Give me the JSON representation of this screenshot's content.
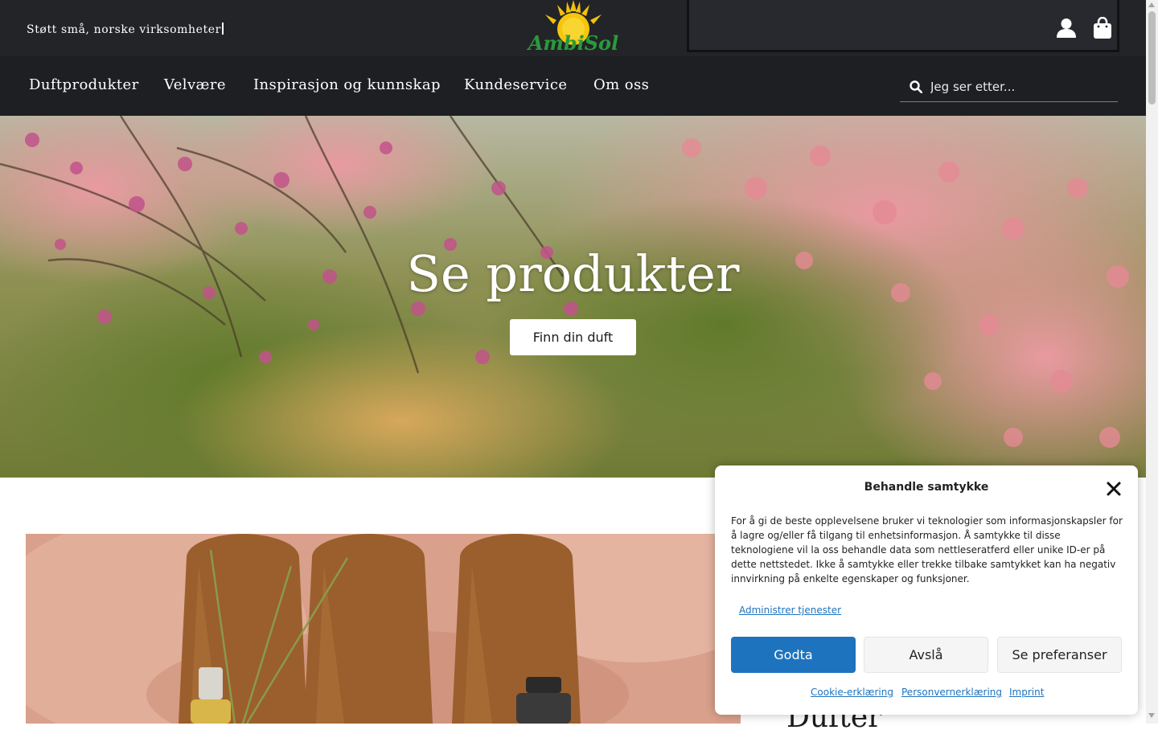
{
  "topbar": {
    "tagline": "Støtt små, norske virksomheter",
    "logo_text": "AmbiSol"
  },
  "nav": {
    "items": [
      "Duftprodukter",
      "Velvære",
      "Inspirasjon og kunnskap",
      "Kundeservice",
      "Om oss"
    ],
    "search_placeholder": "Jeg ser etter..."
  },
  "hero": {
    "title": "Se produkter",
    "button": "Finn din duft"
  },
  "section": {
    "partial_heading": "Dufter"
  },
  "consent": {
    "title": "Behandle samtykke",
    "body": "For å gi de beste opplevelsene bruker vi teknologier som informasjonskapsler for å lagre og/eller få tilgang til enhetsinformasjon. Å samtykke til disse teknologiene vil la oss behandle data som nettleseratferd eller unike ID-er på dette nettstedet. Ikke å samtykke eller trekke tilbake samtykket kan ha negativ innvirkning på enkelte egenskaper og funksjoner.",
    "manage_link": "Administrer tjenester",
    "accept": "Godta",
    "deny": "Avslå",
    "preferences": "Se preferanser",
    "links": [
      "Cookie-erklæring",
      "Personvernerklæring",
      "Imprint"
    ]
  },
  "colors": {
    "topbar_bg": "#222428",
    "nav_bg": "#1d1f22",
    "accent": "#1e73be"
  }
}
